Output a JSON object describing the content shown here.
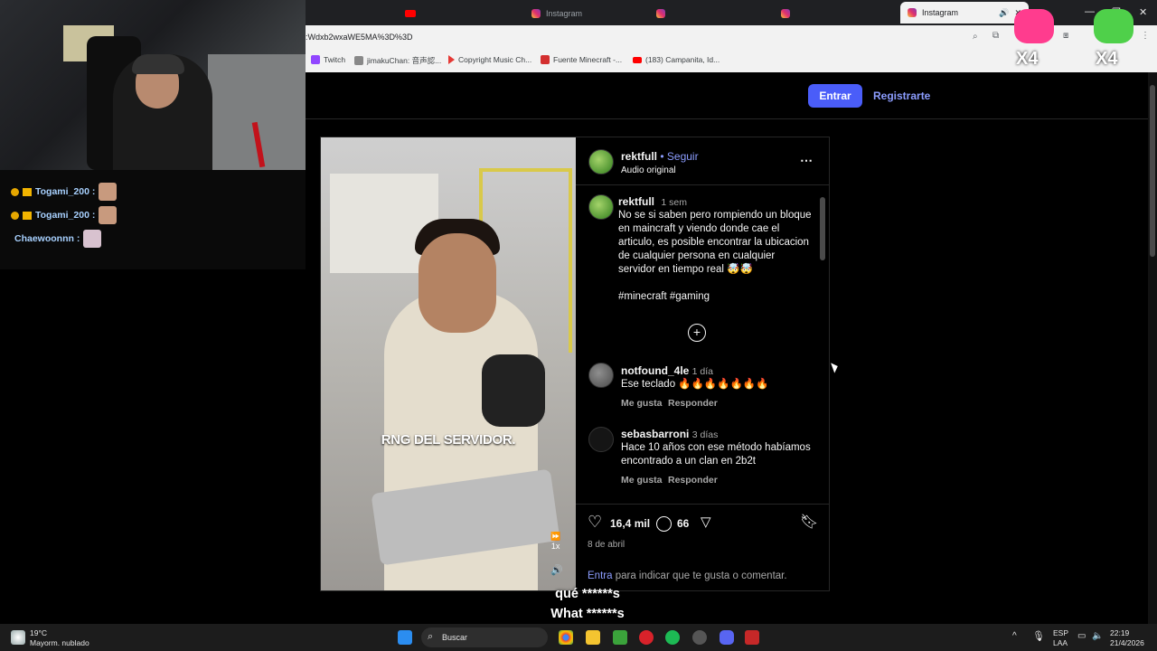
{
  "chat": {
    "rows": [
      {
        "user": "Togami_200 :"
      },
      {
        "user": "Togami_200 :"
      },
      {
        "user": "Chaewoonnn :"
      }
    ]
  },
  "browser": {
    "tabs": [
      "Instagram",
      "Instagram",
      "Instagram",
      "Instagram"
    ],
    "url": ":Wdxb2wxaWE5MA%3D%3D",
    "bookmarks": [
      "Twitch",
      "jimakuChan: 音声認...",
      "Copyright Music Ch...",
      "Fuente Minecraft -...",
      "(183) Campanita, Id..."
    ],
    "stickers": [
      "X4",
      "X4"
    ]
  },
  "nav": {
    "login": "Entrar",
    "register": "Registrarte"
  },
  "post": {
    "video_caption": "RNG DEL SERVIDOR.",
    "speed": "1x",
    "author": "rektfull",
    "follow": "Seguir",
    "audio": "Audio original",
    "more_icon": "ellipsis-icon",
    "caption_time": "1 sem",
    "caption": "No se si saben pero rompiendo un bloque en maincraft y viendo donde cae el articulo, es posible encontrar la ubicacion de cualquier persona en cualquier servidor en tiempo real 🤯🤯",
    "hashtags": "#minecraft #gaming",
    "comments": [
      {
        "user": "notfound_4le",
        "time": "1 día",
        "text": "Ese teclado 🔥🔥🔥🔥🔥🔥🔥",
        "like": "Me gusta",
        "reply": "Responder"
      },
      {
        "user": "sebasbarroni",
        "time": "3 días",
        "text": "Hace 10 años con ese método habíamos encontrado a un clan en 2b2t",
        "like": "Me gusta",
        "reply": "Responder"
      }
    ],
    "likes": "16,4 mil",
    "comment_count": "66",
    "date": "8 de abril",
    "login_prompt_link": "Entra",
    "login_prompt": " para indicar que te gusta o comentar."
  },
  "subtitles": {
    "line1": "qué ******s",
    "line2": "What ******s"
  },
  "taskbar": {
    "weather_temp": "19°C",
    "weather_desc": "Mayorm. nublado",
    "search": "Buscar",
    "lang1": "ESP",
    "lang2": "LAA",
    "time": "22:19",
    "date": "21/4/2026"
  }
}
